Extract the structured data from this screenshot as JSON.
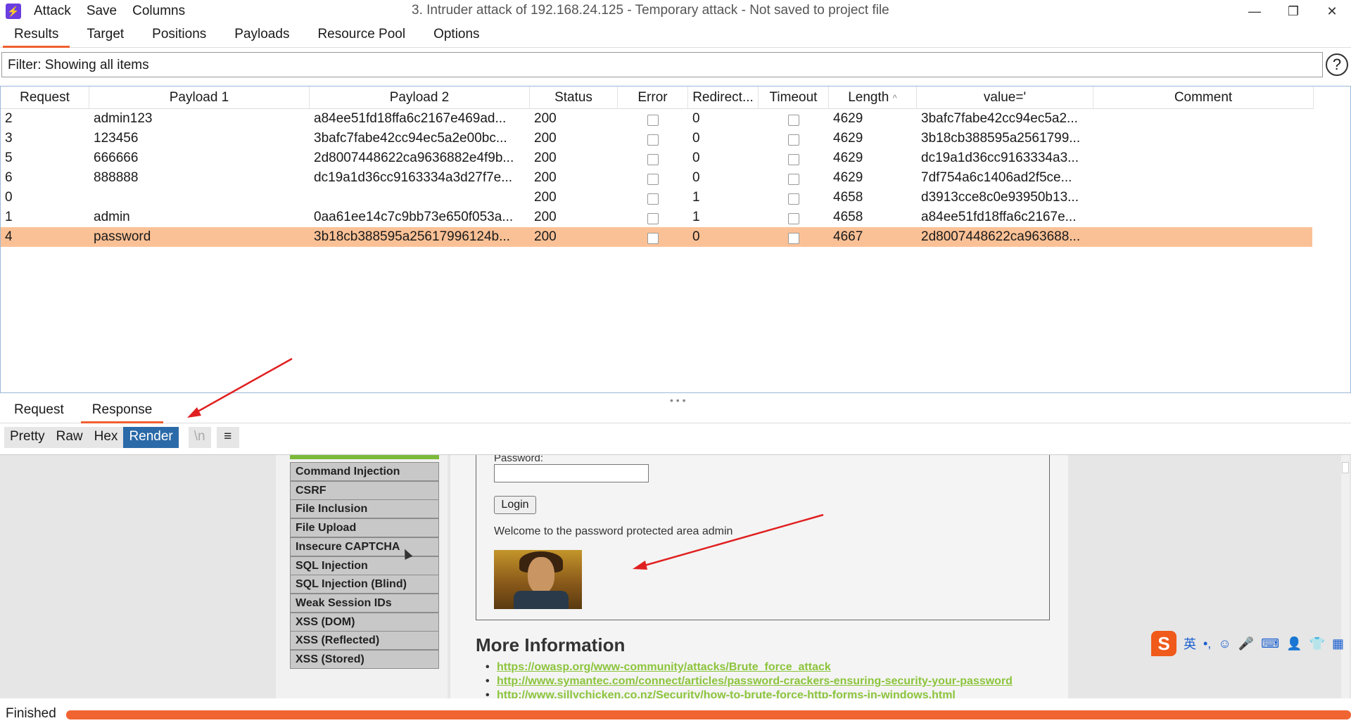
{
  "window": {
    "menu": [
      "Attack",
      "Save",
      "Columns"
    ],
    "title": "3. Intruder attack of 192.168.24.125 - Temporary attack - Not saved to project file",
    "minimize": "—",
    "restore": "❐",
    "close": "✕"
  },
  "main_tabs": [
    "Results",
    "Target",
    "Positions",
    "Payloads",
    "Resource Pool",
    "Options"
  ],
  "filter": {
    "text": "Filter: Showing all items",
    "help": "?"
  },
  "table": {
    "columns": [
      "Request",
      "Payload 1",
      "Payload 2",
      "Status",
      "Error",
      "Redirect...",
      "Timeout",
      "Length",
      "value='",
      "Comment"
    ],
    "sort_indicator": "^",
    "rows": [
      {
        "request": "2",
        "payload1": "admin123",
        "payload2": "a84ee51fd18ffa6c2167e469ad...",
        "status": "200",
        "redirect": "0",
        "length": "4629",
        "value": "3bafc7fabe42cc94ec5a2...",
        "selected": false
      },
      {
        "request": "3",
        "payload1": "123456",
        "payload2": "3bafc7fabe42cc94ec5a2e00bc...",
        "status": "200",
        "redirect": "0",
        "length": "4629",
        "value": "3b18cb388595a2561799...",
        "selected": false
      },
      {
        "request": "5",
        "payload1": "666666",
        "payload2": "2d8007448622ca9636882e4f9b...",
        "status": "200",
        "redirect": "0",
        "length": "4629",
        "value": "dc19a1d36cc9163334a3...",
        "selected": false
      },
      {
        "request": "6",
        "payload1": "888888",
        "payload2": "dc19a1d36cc9163334a3d27f7e...",
        "status": "200",
        "redirect": "0",
        "length": "4629",
        "value": "7df754a6c1406ad2f5ce...",
        "selected": false
      },
      {
        "request": "0",
        "payload1": "",
        "payload2": "",
        "status": "200",
        "redirect": "1",
        "length": "4658",
        "value": "d3913cce8c0e93950b13...",
        "selected": false
      },
      {
        "request": "1",
        "payload1": "admin",
        "payload2": "0aa61ee14c7c9bb73e650f053a...",
        "status": "200",
        "redirect": "1",
        "length": "4658",
        "value": "a84ee51fd18ffa6c2167e...",
        "selected": false
      },
      {
        "request": "4",
        "payload1": "password",
        "payload2": "3b18cb388595a25617996124b...",
        "status": "200",
        "redirect": "0",
        "length": "4667",
        "value": "2d8007448622ca963688...",
        "selected": true
      }
    ]
  },
  "detail_tabs": [
    "Request",
    "Response"
  ],
  "view_buttons": [
    "Pretty",
    "Raw",
    "Hex",
    "Render",
    "\\n",
    "≡"
  ],
  "rendered": {
    "nav": [
      "Command Injection",
      "CSRF",
      "File Inclusion",
      "File Upload",
      "Insecure CAPTCHA",
      "SQL Injection",
      "SQL Injection (Blind)",
      "Weak Session IDs",
      "XSS (DOM)",
      "XSS (Reflected)",
      "XSS (Stored)"
    ],
    "password_label": "Password:",
    "login_button": "Login",
    "welcome": "Welcome to the password protected area admin",
    "more_info_heading": "More Information",
    "links": [
      "https://owasp.org/www-community/attacks/Brute_force_attack",
      "http://www.symantec.com/connect/articles/password-crackers-ensuring-security-your-password",
      "http://www.sillychicken.co.nz/Security/how-to-brute-force-http-forms-in-windows.html"
    ]
  },
  "ime": {
    "logo": "S",
    "lang": "英",
    "items": [
      "•,",
      "☺",
      "🎤",
      "⌨",
      "👤",
      "👕",
      "▦"
    ]
  },
  "status": {
    "text": "Finished",
    "progress": 1.0
  },
  "colors": {
    "accent": "#f06030",
    "selected_row": "#fbc196",
    "render_active": "#2b6aa8",
    "link": "#8cc43c",
    "arrow": "#e02020"
  }
}
